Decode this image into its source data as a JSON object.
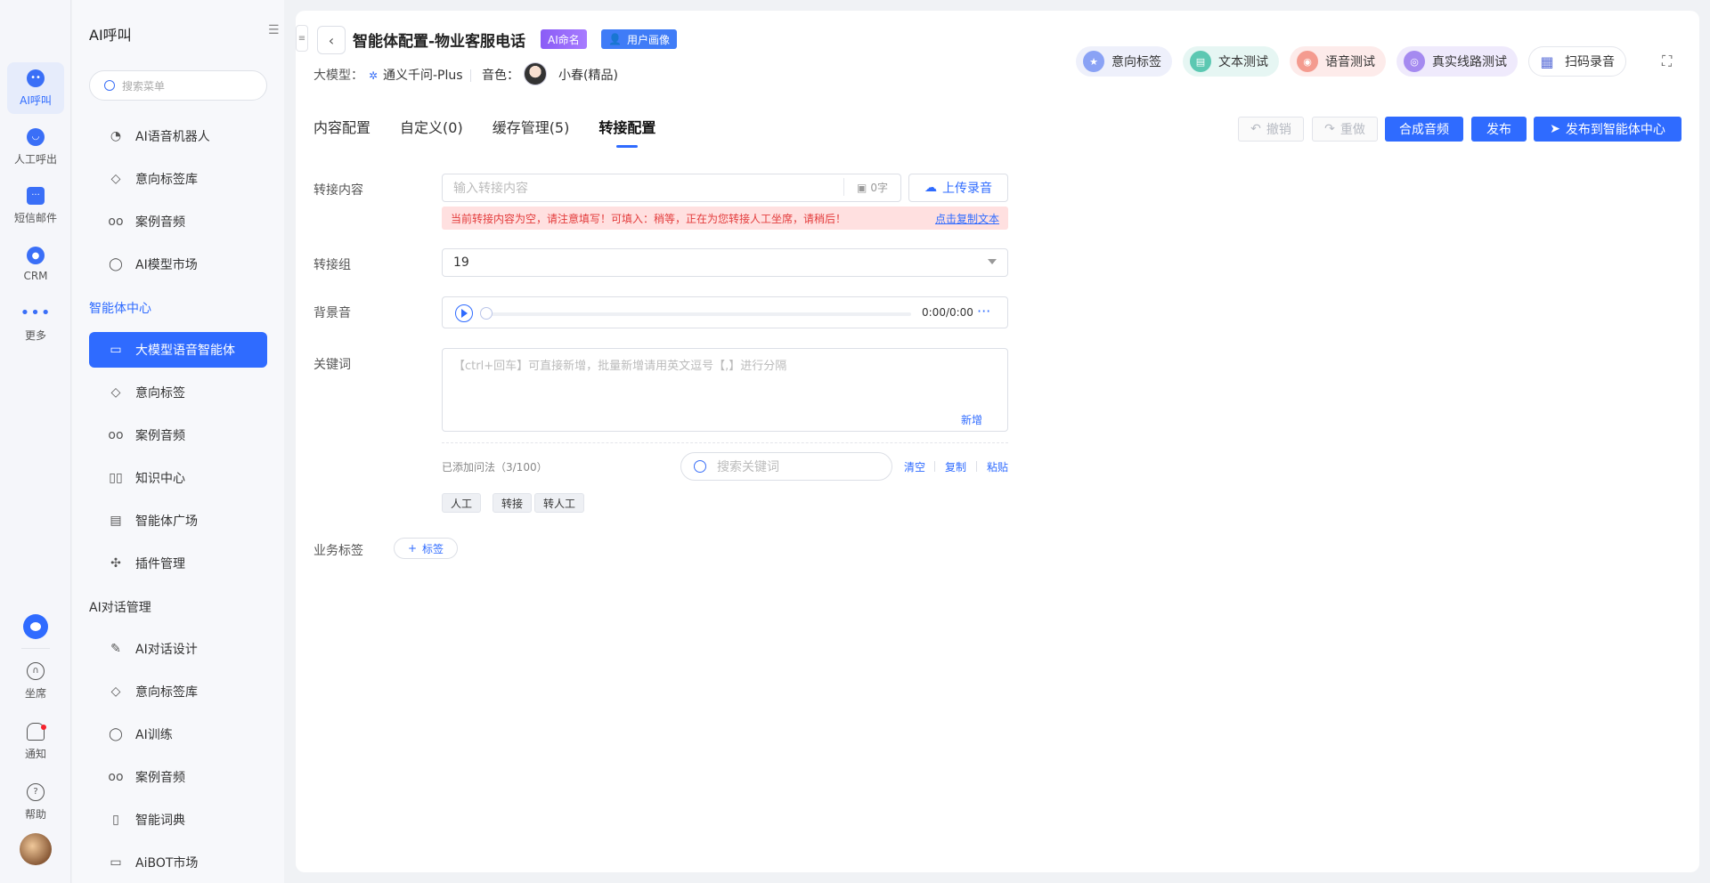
{
  "rail": {
    "items": [
      {
        "label": "AI呼叫",
        "icon": "ai-call-icon"
      },
      {
        "label": "人工呼出",
        "icon": "manual-call-icon"
      },
      {
        "label": "短信邮件",
        "icon": "sms-mail-icon"
      },
      {
        "label": "CRM",
        "icon": "crm-icon"
      },
      {
        "label": "更多",
        "icon": "more-dots-icon"
      }
    ],
    "bottom": [
      {
        "label": "坐席",
        "icon": "headset-icon"
      },
      {
        "label": "通知",
        "icon": "bell-icon"
      },
      {
        "label": "帮助",
        "icon": "help-icon"
      }
    ]
  },
  "menu": {
    "title": "AI呼叫",
    "search_placeholder": "搜索菜单",
    "group1": [
      "AI语音机器人",
      "意向标签库",
      "案例音频",
      "AI模型市场"
    ],
    "section_agent": "智能体中心",
    "group2": [
      "大模型语音智能体",
      "意向标签",
      "案例音频",
      "知识中心",
      "智能体广场",
      "插件管理"
    ],
    "section_dialog": "AI对话管理",
    "group3": [
      "AI对话设计",
      "意向标签库",
      "AI训练",
      "案例音频",
      "智能词典",
      "AiBOT市场"
    ]
  },
  "header": {
    "title": "智能体配置-物业客服电话",
    "badge_ai_name": "AI命名",
    "badge_user_profile": "用户画像",
    "model_label": "大模型：",
    "model_value": "通义千问-Plus",
    "voice_label": "音色：",
    "voice_value": "小春(精品)"
  },
  "tools": [
    "意向标签",
    "文本测试",
    "语音测试",
    "真实线路测试",
    "扫码录音"
  ],
  "tabs": [
    "内容配置",
    "自定义(0)",
    "缓存管理(5)",
    "转接配置"
  ],
  "actions": {
    "undo": "撤销",
    "redo": "重做",
    "synthesize": "合成音频",
    "publish": "发布",
    "publish_center": "发布到智能体中心"
  },
  "form": {
    "transfer_content_label": "转接内容",
    "transfer_content_placeholder": "输入转接内容",
    "char_count": "0字",
    "upload": "上传录音",
    "warning": "当前转接内容为空，请注意填写！可填入：稍等，正在为您转接人工坐席，请稍后！",
    "copy_text": "点击复制文本",
    "group_label": "转接组",
    "group_value": "19",
    "bg_label": "背景音",
    "time": "0:00/0:00",
    "keyword_label": "关键词",
    "keyword_placeholder": "【ctrl+回车】可直接新增，批量新增请用英文逗号【,】进行分隔",
    "add": "新增",
    "added_count": "已添加问法（3/100）",
    "keyword_search_placeholder": "搜索关键词",
    "clear": "清空",
    "copy": "复制",
    "paste": "粘贴",
    "keywords": [
      "人工",
      "转接",
      "转人工"
    ],
    "biz_label": "业务标签",
    "biz_tag": "标签"
  },
  "colors": {
    "primary": "#2f6bff",
    "warning_bg": "#ffe0e0",
    "warning_text": "#e33b3b"
  }
}
